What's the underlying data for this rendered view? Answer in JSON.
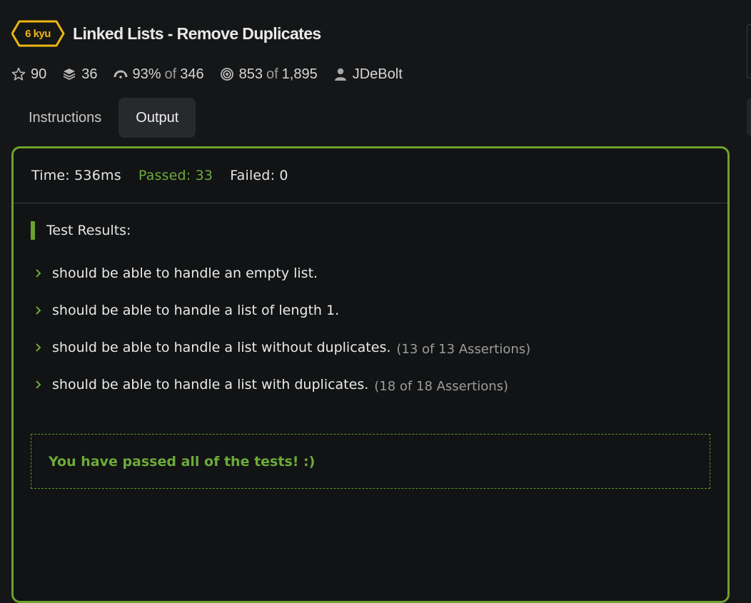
{
  "kata": {
    "rank": "6 kyu",
    "title": "Linked Lists - Remove Duplicates"
  },
  "stats": {
    "stars": "90",
    "collections": "36",
    "satisfaction": "93%",
    "of_word": "of",
    "votes": "346",
    "completed": "853",
    "total": "1,895",
    "author": "JDeBolt"
  },
  "tabs": [
    {
      "label": "Instructions",
      "active": false
    },
    {
      "label": "Output",
      "active": true
    }
  ],
  "summary": {
    "time": "Time: 536ms",
    "passed": "Passed: 33",
    "failed": "Failed: 0"
  },
  "results": {
    "heading": "Test Results:",
    "items": [
      {
        "label": "should be able to handle an empty list.",
        "assertions": ""
      },
      {
        "label": "should be able to handle a list of length 1.",
        "assertions": ""
      },
      {
        "label": "should be able to handle a list without duplicates.",
        "assertions": "(13 of 13 Assertions)"
      },
      {
        "label": "should be able to handle a list with duplicates.",
        "assertions": "(18 of 18 Assertions)"
      }
    ],
    "passed_message": "You have passed all of the tests! :)"
  },
  "icons": {
    "star": "star-icon",
    "collections": "layers-icon",
    "satisfaction": "gauge-icon",
    "completed": "target-icon",
    "author": "user-icon",
    "expand": "chevron-right-icon"
  },
  "colors": {
    "accent_green": "#6ca22f",
    "rank_yellow": "#ecb613",
    "background": "#151617"
  }
}
